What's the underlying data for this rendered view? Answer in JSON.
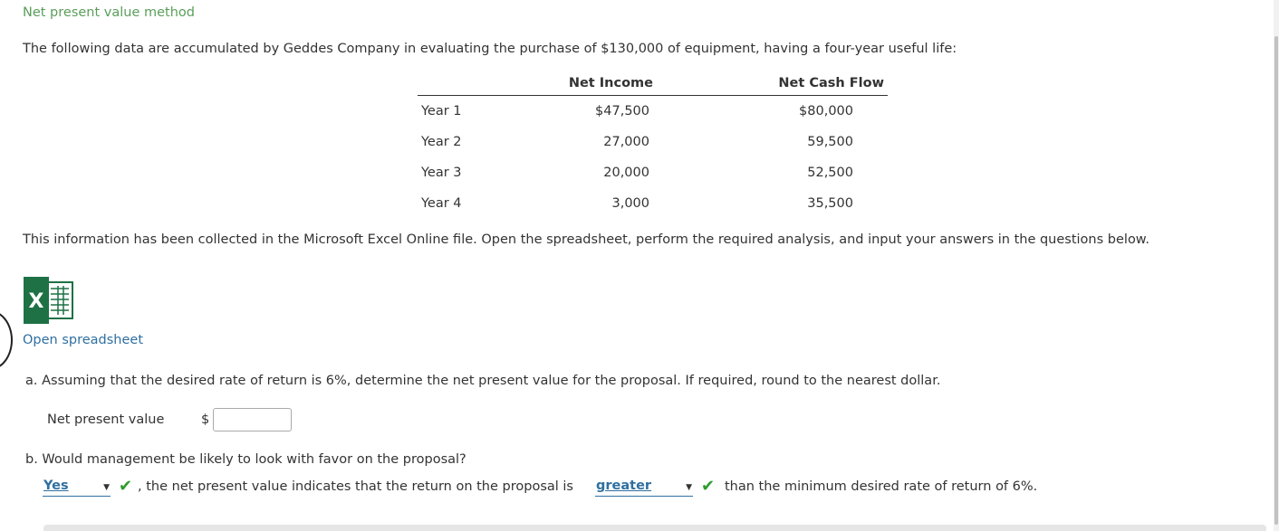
{
  "title": "Net present value method",
  "intro": "The following data are accumulated by Geddes Company in evaluating the purchase of $130,000 of equipment, having a four-year useful life:",
  "table": {
    "headers": [
      "",
      "Net Income",
      "Net Cash Flow"
    ],
    "rows": [
      {
        "year": "Year 1",
        "net_income": "$47,500",
        "net_cash_flow": "$80,000"
      },
      {
        "year": "Year 2",
        "net_income": "27,000",
        "net_cash_flow": "59,500"
      },
      {
        "year": "Year 3",
        "net_income": "20,000",
        "net_cash_flow": "52,500"
      },
      {
        "year": "Year 4",
        "net_income": "3,000",
        "net_cash_flow": "35,500"
      }
    ]
  },
  "info": "This information has been collected in the Microsoft Excel Online file. Open the spreadsheet, perform the required analysis, and input your answers in the questions below.",
  "excel_icon_letter": "X",
  "open_spreadsheet_label": "Open spreadsheet",
  "question_a": "a. Assuming that the desired rate of return is 6%, determine the net present value for the proposal. If required, round to the nearest dollar.",
  "npv_label": "Net present value",
  "currency_symbol": "$",
  "npv_value": "",
  "question_b": "b. Would management be likely to look with favor on the proposal?",
  "answer_b": {
    "favor_select": "Yes",
    "middle_text": ", the net present value indicates that the return on the proposal is",
    "comparison_select": "greater",
    "end_text": "than the minimum desired rate of return of 6%."
  },
  "colors": {
    "title": "#5a9e5a",
    "link": "#2f6fa0",
    "check": "#2e9c2e",
    "excel_green": "#1e7145"
  },
  "icons": [
    "excel-icon",
    "check-icon",
    "dropdown-arrow-icon"
  ]
}
